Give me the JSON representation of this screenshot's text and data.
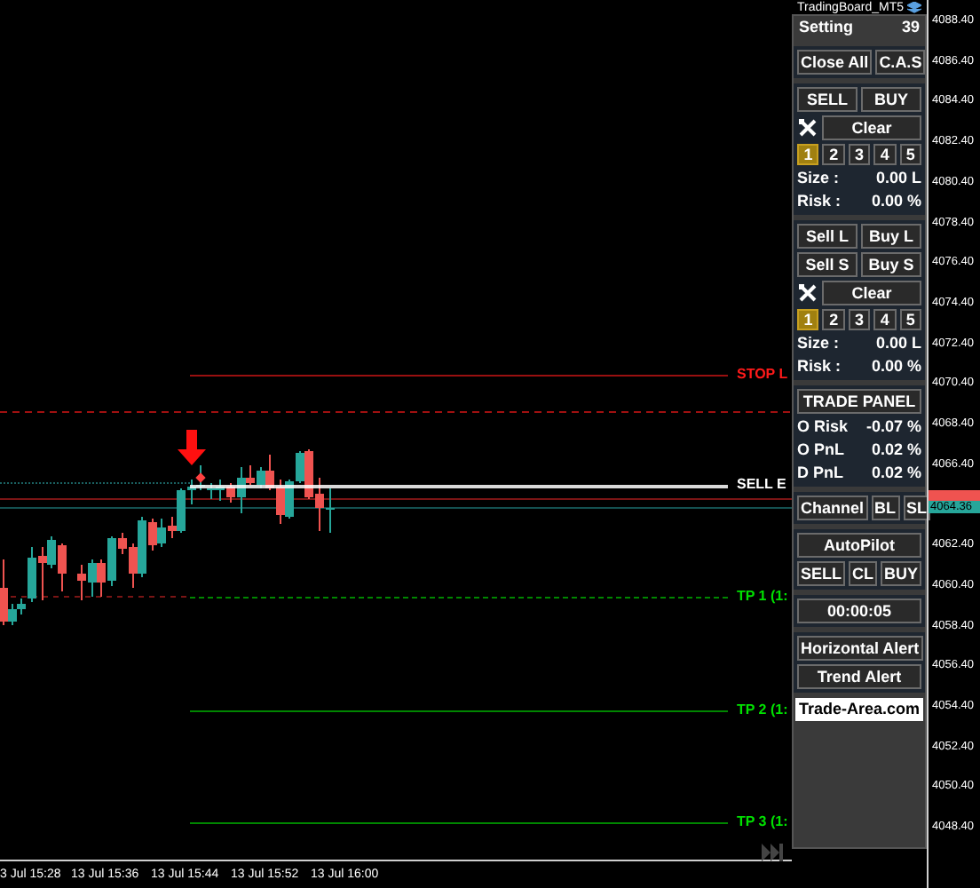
{
  "chart": {
    "levels": [
      {
        "label": "STOP L",
        "color": "#ff1a1a"
      },
      {
        "label": "SELL E",
        "color": "#ffffff"
      },
      {
        "label": "TP 1 (1:",
        "color": "#00e000"
      },
      {
        "label": "TP 2 (1:",
        "color": "#00e000"
      },
      {
        "label": "TP 3 (1:",
        "color": "#00e000"
      }
    ],
    "time_axis": [
      "3 Jul 15:28",
      "13 Jul 15:36",
      "13 Jul 15:44",
      "13 Jul 15:52",
      "13 Jul 16:00"
    ],
    "price_axis": [
      "4088.40",
      "4086.40",
      "4084.40",
      "4082.40",
      "4080.40",
      "4078.40",
      "4076.40",
      "4074.40",
      "4072.40",
      "4070.40",
      "4068.40",
      "4066.40",
      "4062.40",
      "4060.40",
      "4058.40",
      "4056.40",
      "4054.40",
      "4052.40",
      "4050.40",
      "4048.40"
    ],
    "price_tag": {
      "text": "4064.36",
      "color": "#26a69a"
    }
  },
  "panel": {
    "title": "TradingBoard_MT5",
    "setting_label": "Setting",
    "setting_value": "39",
    "sections": [
      {
        "rows": [
          {
            "kind": "buttons",
            "items": [
              "Close All",
              "C.A.S"
            ]
          }
        ]
      },
      {
        "rows": [
          {
            "kind": "buttons",
            "items": [
              "SELL",
              "BUY"
            ]
          },
          {
            "kind": "tool_clear",
            "label": "Clear"
          },
          {
            "kind": "numbers",
            "items": [
              {
                "label": "1",
                "selected": true
              },
              {
                "label": "2",
                "selected": false
              },
              {
                "label": "3",
                "selected": false
              },
              {
                "label": "4",
                "selected": false
              },
              {
                "label": "5",
                "selected": false
              }
            ]
          },
          {
            "kind": "stat",
            "label": "Size :",
            "value": "0.00 L"
          },
          {
            "kind": "stat",
            "label": "Risk :",
            "value": "0.00 %"
          }
        ]
      },
      {
        "rows": [
          {
            "kind": "buttons",
            "items": [
              "Sell L",
              "Buy L"
            ]
          },
          {
            "kind": "buttons",
            "items": [
              "Sell S",
              "Buy S"
            ]
          },
          {
            "kind": "tool_clear",
            "label": "Clear"
          },
          {
            "kind": "numbers",
            "items": [
              {
                "label": "1",
                "selected": true
              },
              {
                "label": "2",
                "selected": false
              },
              {
                "label": "3",
                "selected": false
              },
              {
                "label": "4",
                "selected": false
              },
              {
                "label": "5",
                "selected": false
              }
            ]
          },
          {
            "kind": "stat",
            "label": "Size :",
            "value": "0.00 L"
          },
          {
            "kind": "stat",
            "label": "Risk :",
            "value": "0.00 %"
          }
        ]
      },
      {
        "rows": [
          {
            "kind": "buttons",
            "items": [
              "TRADE PANEL"
            ]
          },
          {
            "kind": "stat",
            "label": "O Risk",
            "value": "-0.07 %"
          },
          {
            "kind": "stat",
            "label": "O PnL",
            "value": "0.02 %"
          },
          {
            "kind": "stat",
            "label": "D PnL",
            "value": "0.02 %"
          }
        ]
      },
      {
        "rows": [
          {
            "kind": "buttons",
            "items": [
              "Channel",
              "BL",
              "SL"
            ]
          }
        ]
      },
      {
        "rows": [
          {
            "kind": "buttons",
            "items": [
              "AutoPilot"
            ]
          },
          {
            "kind": "buttons",
            "items": [
              "SELL",
              "CL",
              "BUY"
            ]
          }
        ]
      },
      {
        "rows": [
          {
            "kind": "buttons",
            "items": [
              "00:00:05"
            ]
          }
        ]
      },
      {
        "rows": [
          {
            "kind": "buttons",
            "items": [
              "Horizontal Alert"
            ]
          },
          {
            "kind": "buttons",
            "items": [
              "Trend Alert"
            ]
          }
        ]
      }
    ],
    "link": "Trade-Area.com"
  }
}
